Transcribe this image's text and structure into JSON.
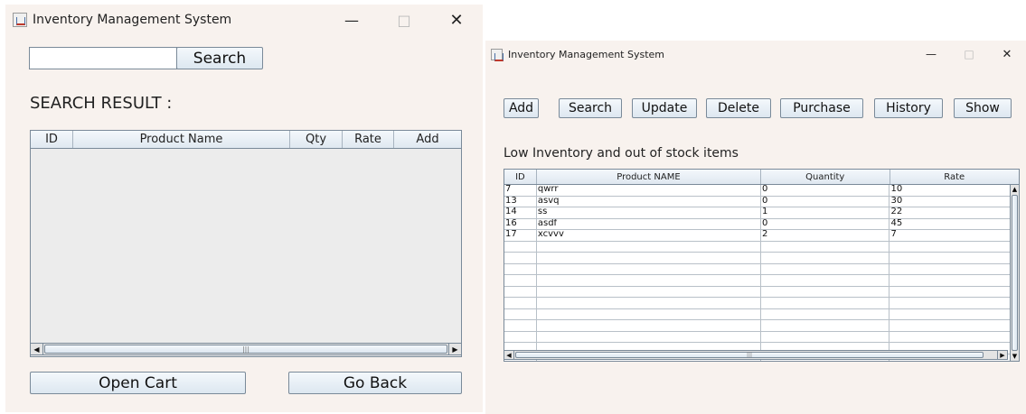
{
  "left_window": {
    "title": "Inventory Management System",
    "controls": {
      "minimize": "—",
      "maximize": "□",
      "close": "✕"
    },
    "search": {
      "value": "",
      "placeholder": "",
      "button_label": "Search"
    },
    "result_heading": "SEARCH RESULT :",
    "table": {
      "columns": [
        "ID",
        "Product Name",
        "Qty",
        "Rate",
        "Add"
      ],
      "rows": []
    },
    "buttons": {
      "open_cart": "Open Cart",
      "go_back": "Go Back"
    }
  },
  "right_window": {
    "title": "Inventory Management System",
    "controls": {
      "minimize": "—",
      "maximize": "□",
      "close": "✕"
    },
    "toolbar": [
      "Add",
      "Search",
      "Update",
      "Delete",
      "Purchase",
      "History",
      "Show"
    ],
    "section_heading": "Low Inventory and out of stock items",
    "table": {
      "columns": [
        "ID",
        "Product NAME",
        "Quantity",
        "Rate"
      ],
      "rows": [
        [
          "7",
          "qwrr",
          "0",
          "10"
        ],
        [
          "13",
          "asvq",
          "0",
          "30"
        ],
        [
          "14",
          "ss",
          "1",
          "22"
        ],
        [
          "16",
          "asdf",
          "0",
          "45"
        ],
        [
          "17",
          "xcvvv",
          "2",
          "7"
        ]
      ],
      "empty_rows": 11
    }
  },
  "icons": {
    "app": "java-cup-icon",
    "scroll_left": "arrow-left-icon",
    "scroll_right": "arrow-right-icon",
    "scroll_up": "arrow-up-icon",
    "scroll_down": "arrow-down-icon"
  },
  "colors": {
    "window_bg": "#f8f2ee",
    "table_bg": "#ececec",
    "button_gradient_top": "#f4f8fc",
    "button_gradient_bottom": "#dde7f0",
    "border": "#7a8a99"
  }
}
